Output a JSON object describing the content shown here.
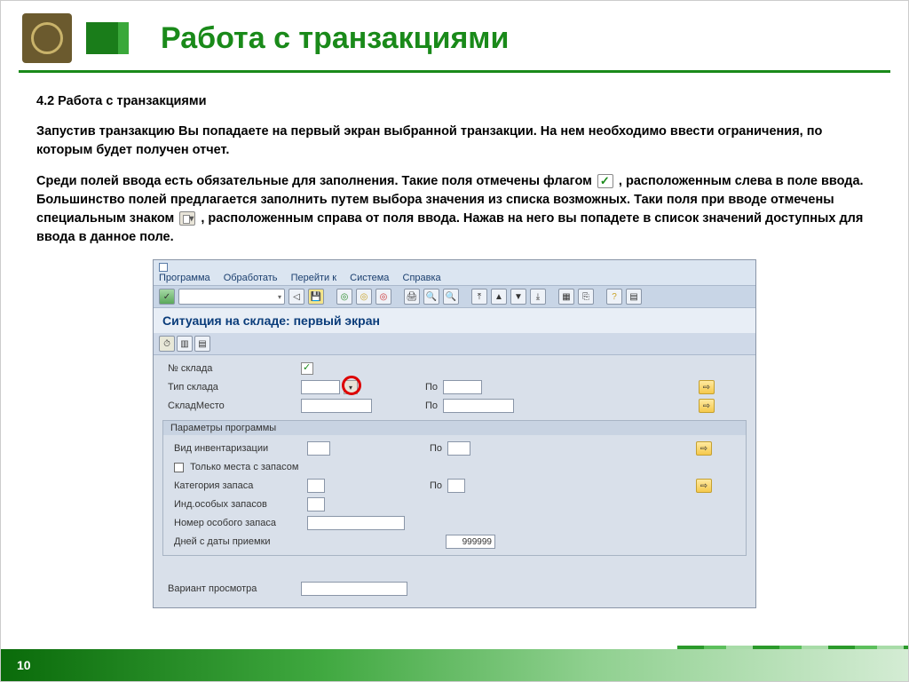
{
  "header": {
    "title": "Работа с транзакциями"
  },
  "body": {
    "section_heading": "4.2 Работа с транзакциями",
    "para1": "Запустив транзакцию Вы попадаете на первый экран выбранной транзакции.  На нем необходимо ввести ограничения, по которым будет получен отчет.",
    "para2a": "Среди полей ввода есть обязательные для заполнения. Такие поля отмечены флагом ",
    "para2b": ", расположенным слева в поле ввода. Большинство полей предлагается заполнить путем выбора  значения из списка возможных. Таки поля при вводе отмечены специальным знаком ",
    "para2c": ", расположенным справа от поля ввода. Нажав на него вы попадете в список значений доступных для ввода в данное поле."
  },
  "sap": {
    "menu": [
      "Программа",
      "Обработать",
      "Перейти к",
      "Система",
      "Справка"
    ],
    "screen_title": "Ситуация на складе: первый экран",
    "fields": {
      "warehouse_num": "№ склада",
      "storage_type": "Тип склада",
      "storage_bin": "СкладМесто",
      "to": "По"
    },
    "group": {
      "title": "Параметры программы",
      "inventory_type": "Вид инвентаризации",
      "only_with_stock": "Только места с запасом",
      "stock_category": "Категория запаса",
      "special_stock_ind": "Инд.особых запасов",
      "special_stock_num": "Номер особого запаса",
      "days_since_receipt": "Дней с даты приемки",
      "days_value": "999999"
    },
    "variant_label": "Вариант просмотра"
  },
  "footer": {
    "page_num": "10"
  }
}
